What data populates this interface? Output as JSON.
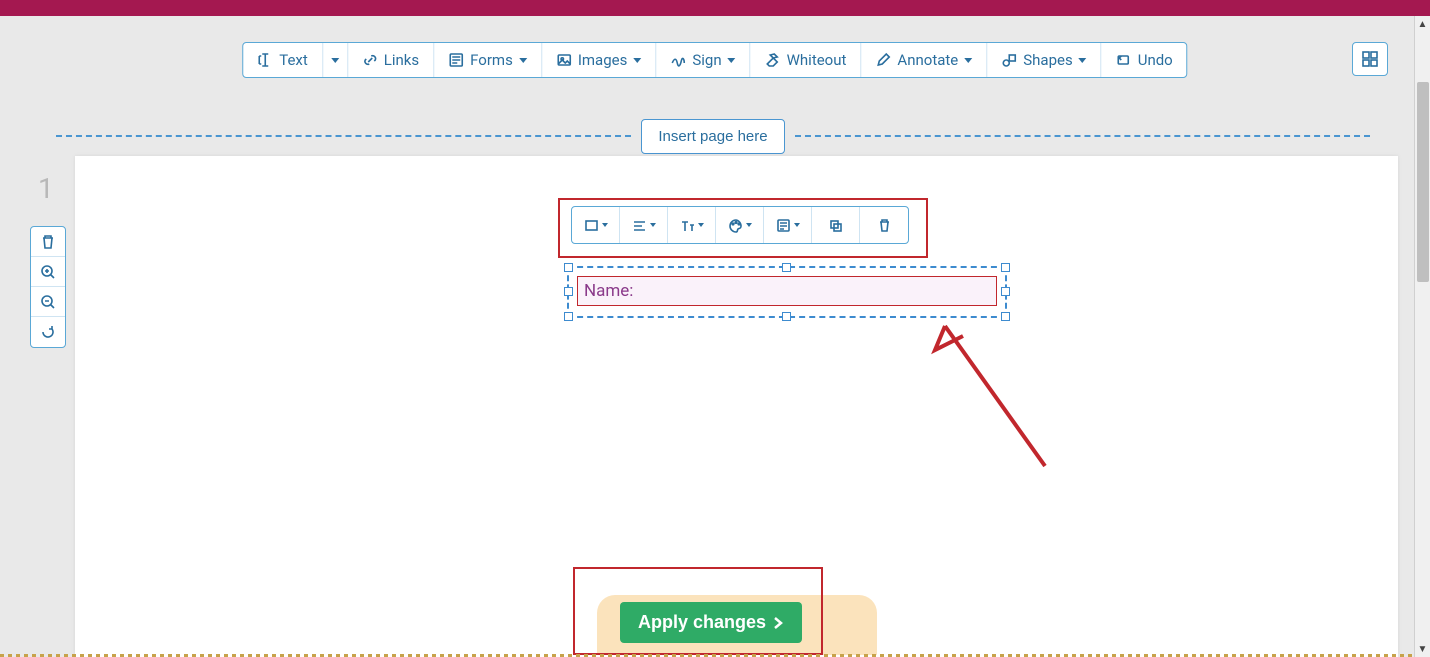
{
  "toolbar": {
    "text": "Text",
    "links": "Links",
    "forms": "Forms",
    "images": "Images",
    "sign": "Sign",
    "whiteout": "Whiteout",
    "annotate": "Annotate",
    "shapes": "Shapes",
    "undo": "Undo"
  },
  "insert_page": "Insert page here",
  "page_number": "1",
  "form_field": {
    "label": "Name:"
  },
  "apply_changes": "Apply changes"
}
